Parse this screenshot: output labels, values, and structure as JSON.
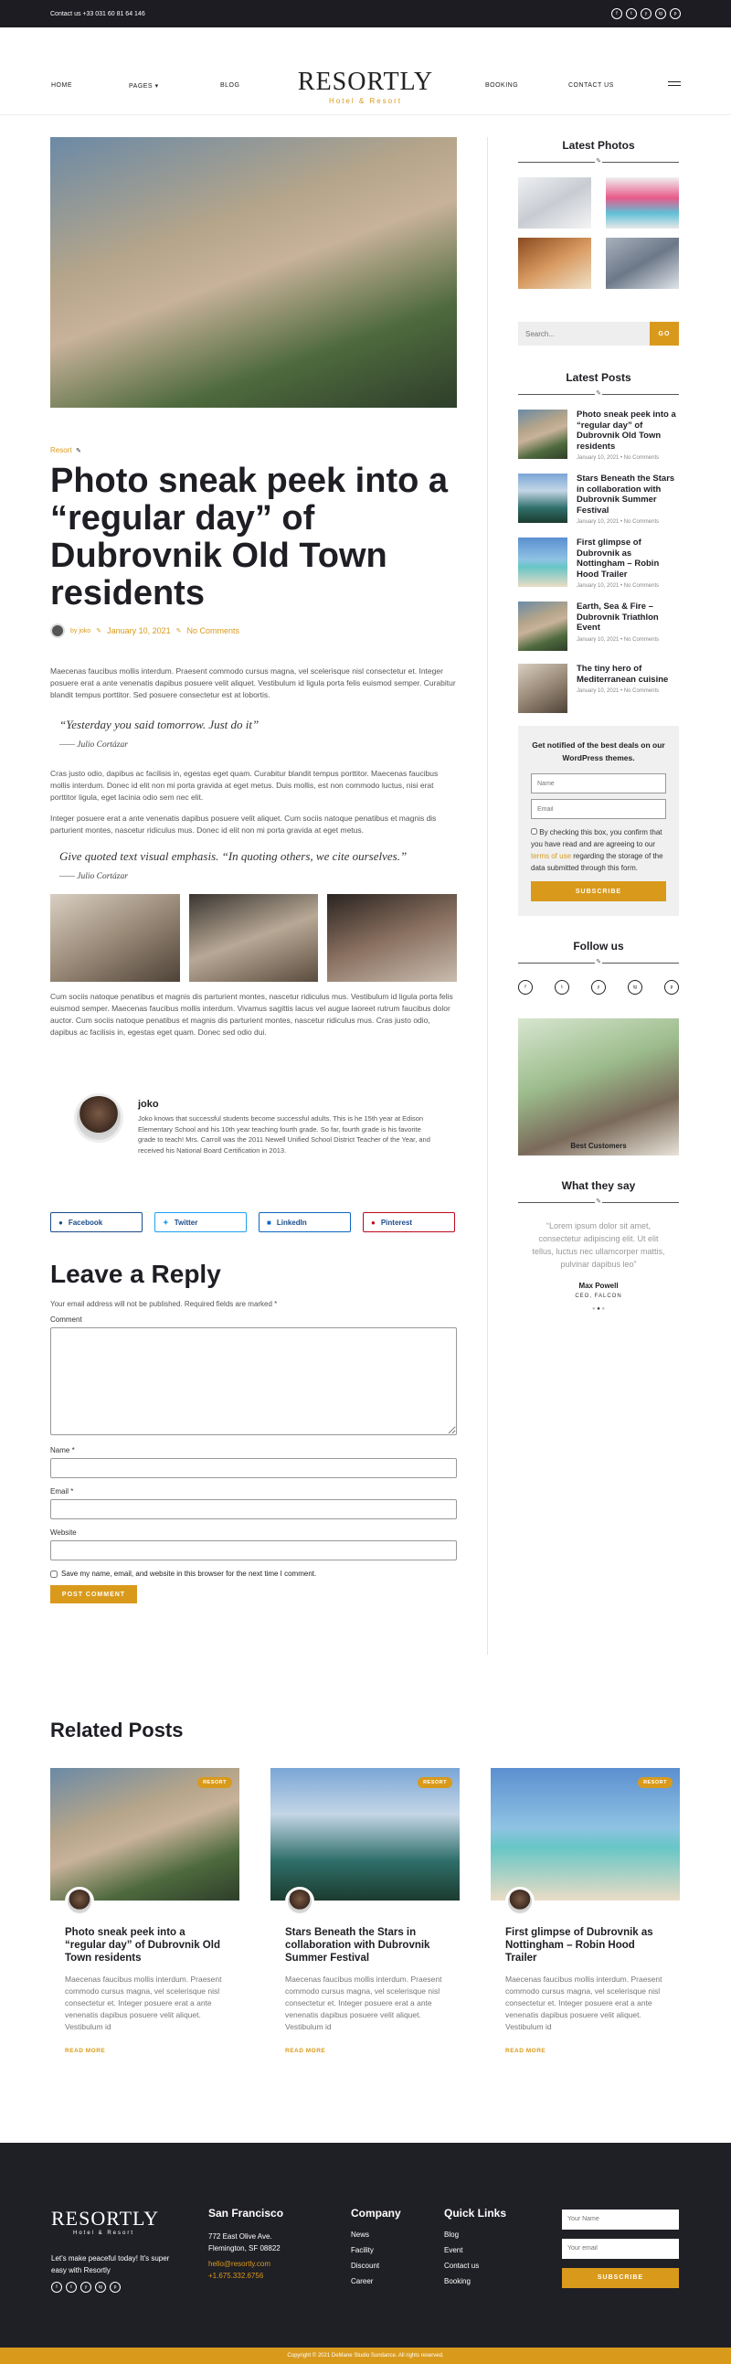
{
  "topbar": {
    "contact": "Contact us +33 031 60 81 64 146",
    "social": [
      "f",
      "t",
      "y",
      "ig",
      "p"
    ]
  },
  "nav": {
    "items": [
      "HOME",
      "PAGES",
      "BLOG",
      "BOOKING",
      "CONTACT US"
    ],
    "logo": "RESORTLY",
    "logo_sub": "Hotel & Resort"
  },
  "post": {
    "category": "Resort",
    "title": "Photo sneak peek into a “regular day” of Dubrovnik Old Town residents",
    "author": "by joko",
    "date": "January 10, 2021",
    "comments": "No Comments",
    "p1": "Maecenas faucibus mollis interdum. Praesent commodo cursus magna, vel scelerisque nisl consectetur et. Integer posuere erat a ante venenatis dapibus posuere velit aliquet. Vestibulum id ligula porta felis euismod semper. Curabitur blandit tempus porttitor. Sed posuere consectetur est at lobortis.",
    "q1": "“Yesterday you said tomorrow. Just do it”",
    "q1_author": "—— Julio Cortázar",
    "p2": "Cras justo odio, dapibus ac facilisis in, egestas eget quam. Curabitur blandit tempus porttitor. Maecenas faucibus mollis interdum. Donec id elit non mi porta gravida at eget metus. Duis mollis, est non commodo luctus, nisi erat porttitor ligula, eget lacinia odio sem nec elit.",
    "p3": "Integer posuere erat a ante venenatis dapibus posuere velit aliquet. Cum sociis natoque penatibus et magnis dis parturient montes, nascetur ridiculus mus. Donec id elit non mi porta gravida at eget metus.",
    "q2": "Give quoted text visual emphasis. “In quoting others, we cite ourselves.”",
    "q2_author": "—— Julio Cortázar",
    "p4": "Cum sociis natoque penatibus et magnis dis parturient montes, nascetur ridiculus mus. Vestibulum id ligula porta felis euismod semper. Maecenas faucibus mollis interdum. Vivamus sagittis lacus vel augue laoreet rutrum faucibus dolor auctor. Cum sociis natoque penatibus et magnis dis parturient montes, nascetur ridiculus mus. Cras justo odio, dapibus ac facilisis in, egestas eget quam. Donec sed odio dui."
  },
  "author_box": {
    "name": "joko",
    "bio": "Joko knows that successful students become successful adults. This is he 15th year at Edison Elementary School and his 10th year teaching fourth grade. So far, fourth grade is his favorite grade to teach! Mrs. Carroll was the 2011 Newell Unified School District Teacher of the Year, and received his National Board Certification in 2013."
  },
  "share": {
    "facebook": "Facebook",
    "twitter": "Twitter",
    "linkedin": "LinkedIn",
    "pinterest": "Pinterest",
    "colors": {
      "facebook": "#1b4b8a",
      "twitter": "#1da1f2",
      "linkedin": "#0a66c2",
      "pinterest": "#bd081c"
    }
  },
  "reply": {
    "title": "Leave a Reply",
    "note": "Your email address will not be published. Required fields are marked *",
    "comment": "Comment",
    "name": "Name *",
    "email": "Email *",
    "website": "Website",
    "save": "Save my name, email, and website in this browser for the next time I comment.",
    "submit": "POST COMMENT"
  },
  "sidebar": {
    "latest_photos": "Latest Photos",
    "search_placeholder": "Search...",
    "search_btn": "GO",
    "latest_posts": "Latest Posts",
    "posts": [
      {
        "title": "Photo sneak peek into a “regular day” of Dubrovnik Old Town residents",
        "meta": "January 10, 2021 • No Comments"
      },
      {
        "title": "Stars Beneath the Stars in collaboration with Dubrovnik Summer Festival",
        "meta": "January 10, 2021 • No Comments"
      },
      {
        "title": "First glimpse of Dubrovnik as Nottingham – Robin Hood Trailer",
        "meta": "January 10, 2021 • No Comments"
      },
      {
        "title": "Earth, Sea & Fire – Dubrovnik Triathlon Event",
        "meta": "January 10, 2021 • No Comments"
      },
      {
        "title": "The tiny hero of Mediterranean cuisine",
        "meta": "January 10, 2021 • No Comments"
      }
    ],
    "newsletter": {
      "title": "Get notified of the best deals on our WordPress themes.",
      "name_ph": "Name",
      "email_ph": "Email",
      "consent1": "By checking this box, you confirm that you have read and are agreeing to our",
      "terms": "terms of use",
      "consent2": "regarding the storage of the data submitted through this form.",
      "btn": "SUBSCRIBE"
    },
    "follow": "Follow us",
    "best": "Best Customers",
    "what": "What they say",
    "testimonial": "“Lorem ipsum dolor sit amet, consectetur adipiscing elit. Ut elit tellus, luctus nec ullamcorper mattis, pulvinar dapibus leo”",
    "t_name": "Max Powell",
    "t_role": "CEO, FALCON"
  },
  "related": {
    "title": "Related Posts",
    "badge": "RESORT",
    "more": "READ MORE",
    "cards": [
      {
        "title": "Photo sneak peek into a “regular day” of Dubrovnik Old Town residents",
        "text": "Maecenas faucibus mollis interdum. Praesent commodo cursus magna, vel scelerisque nisl consectetur et. Integer posuere erat a ante venenatis dapibus posuere velit aliquet. Vestibulum id"
      },
      {
        "title": "Stars Beneath the Stars in collaboration with Dubrovnik Summer Festival",
        "text": "Maecenas faucibus mollis interdum. Praesent commodo cursus magna, vel scelerisque nisl consectetur et. Integer posuere erat a ante venenatis dapibus posuere velit aliquet. Vestibulum id"
      },
      {
        "title": "First glimpse of Dubrovnik as Nottingham – Robin Hood Trailer",
        "text": "Maecenas faucibus mollis interdum. Praesent commodo cursus magna, vel scelerisque nisl consectetur et. Integer posuere erat a ante venenatis dapibus posuere velit aliquet. Vestibulum id"
      }
    ]
  },
  "footer": {
    "logo": "RESORTLY",
    "logo_sub": "Hotel & Resort",
    "tagline": "Let's make peaceful today! It's super easy with Resortly",
    "city": "San Francisco",
    "address1": "772 East Olive Ave.",
    "address2": "Flemington, SF 08822",
    "email": "hello@resortly.com",
    "phone": "+1.675.332.6756",
    "company": "Company",
    "company_items": [
      "News",
      "Facility",
      "Discount",
      "Career"
    ],
    "quick": "Quick Links",
    "quick_items": [
      "Blog",
      "Event",
      "Contact us",
      "Booking"
    ],
    "name_ph": "Your Name",
    "email_ph": "Your email",
    "btn": "SUBSCRIBE",
    "copyright": "Copyright © 2021 DeMane Studio Sundance. All rights reserved."
  }
}
